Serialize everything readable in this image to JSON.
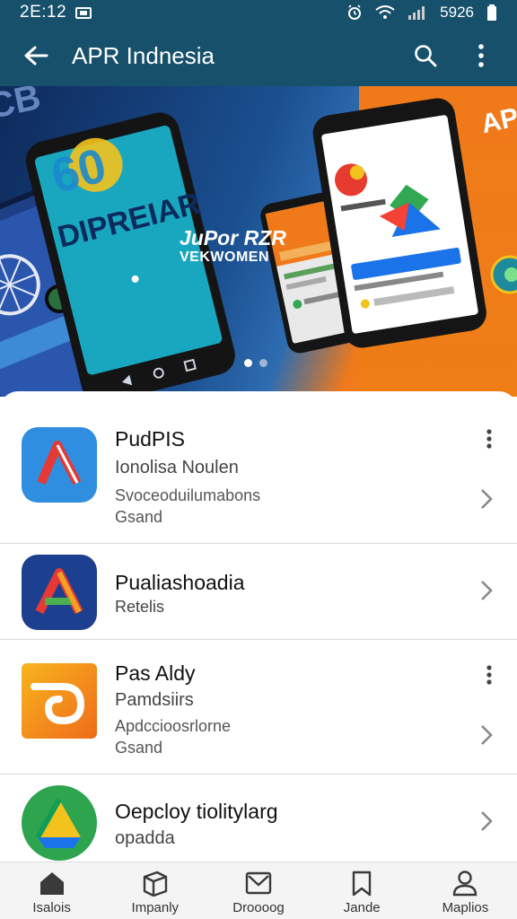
{
  "status_bar": {
    "time": "2E:12",
    "right_text": "5926"
  },
  "app_bar": {
    "title": "APR Indnesia"
  },
  "banner": {
    "headline": "JuPor RZR",
    "subline": "VEKWOMEN",
    "phone_text": "DIPREIAR",
    "side_text": "APK"
  },
  "apps": [
    {
      "name": "PudPIS",
      "line1": "Ionolisa Noulen",
      "line2": "Svoceoduilumabons",
      "line3": "Gsand",
      "icon": "red-arrow-a-icon"
    },
    {
      "name": "Pualiashoadia",
      "line1": "Retelis",
      "icon": "tricolor-a-icon"
    },
    {
      "name": "Pas Aldy",
      "line1": "Pamdsiirs",
      "line2": "Apdccioosrlorne",
      "line3": "Gsand",
      "icon": "orange-swirl-icon"
    },
    {
      "name": "Oepcloy tiolitylarg",
      "line1": "opadda",
      "icon": "drive-triangle-icon"
    }
  ],
  "bottom_nav": [
    {
      "label": "Isalois",
      "icon": "home-icon"
    },
    {
      "label": "Impanly",
      "icon": "box-icon"
    },
    {
      "label": "Droooog",
      "icon": "mail-icon"
    },
    {
      "label": "Jande",
      "icon": "bookmark-icon"
    },
    {
      "label": "Maplios",
      "icon": "person-icon"
    }
  ],
  "colors": {
    "app_bar": "#17506b",
    "banner_orange": "#f07a1a",
    "banner_blue": "#1a4f8f"
  }
}
